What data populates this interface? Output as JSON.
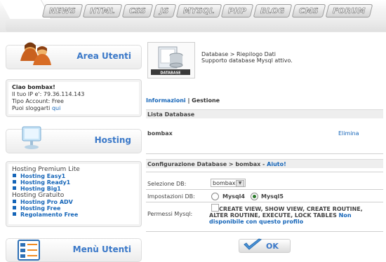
{
  "nav": {
    "tabs": [
      "NEWS",
      "HTML",
      "CSS",
      "JS",
      "MYSQL",
      "PHP",
      "BLOG",
      "CMS",
      "FORUM"
    ]
  },
  "area_utenti": {
    "title": "Area Utenti",
    "greeting": "Ciao bombax!",
    "ip_text": "Il tuo IP e': 79.36.114.143",
    "account_text": "Tipo Account: Free",
    "logout_prefix": "Puoi sloggarti ",
    "logout_link": "qui"
  },
  "hosting": {
    "title": "Hosting",
    "groups": [
      {
        "heading": "Hosting Premium Lite",
        "items": [
          "Hosting Easy1",
          "Hosting Ready1",
          "Hosting Big1"
        ]
      },
      {
        "heading": "Hosting Gratuito",
        "items": [
          "Hosting Pro ADV",
          "Hosting Free",
          "Regolamento Free"
        ]
      }
    ]
  },
  "menu_utenti": {
    "title": "Menù Utenti"
  },
  "db": {
    "icon_label": "DATABASE",
    "breadcrumb": "Database > Riepilogo Dati",
    "status": "Supporto database Mysql attivo.",
    "link_info": "Informazioni",
    "link_sep": " | ",
    "link_gestione": "Gestione",
    "list_header": "Lista Database",
    "db_name": "bombax",
    "delete_label": "Elimina",
    "config_header": "Configurazione Database > bombax - ",
    "help_link": "Aiuto!",
    "select_label": "Selezione DB:",
    "select_value": "bombax",
    "settings_label": "Impostazioni DB:",
    "mysql4": "Mysql4",
    "mysql5": "Mysql5",
    "mysql5_selected": true,
    "perms_label": "Permessi Mysql:",
    "perms_text": "CREATE VIEW, SHOW VIEW, CREATE ROUTINE, ALTER ROUTINE, EXECUTE, LOCK TABLES",
    "perms_unavailable": "Non disponibile con questo profilo",
    "ok_label": "OK"
  },
  "colors": {
    "link": "#1565b8",
    "title_blue": "#3a78c8"
  }
}
